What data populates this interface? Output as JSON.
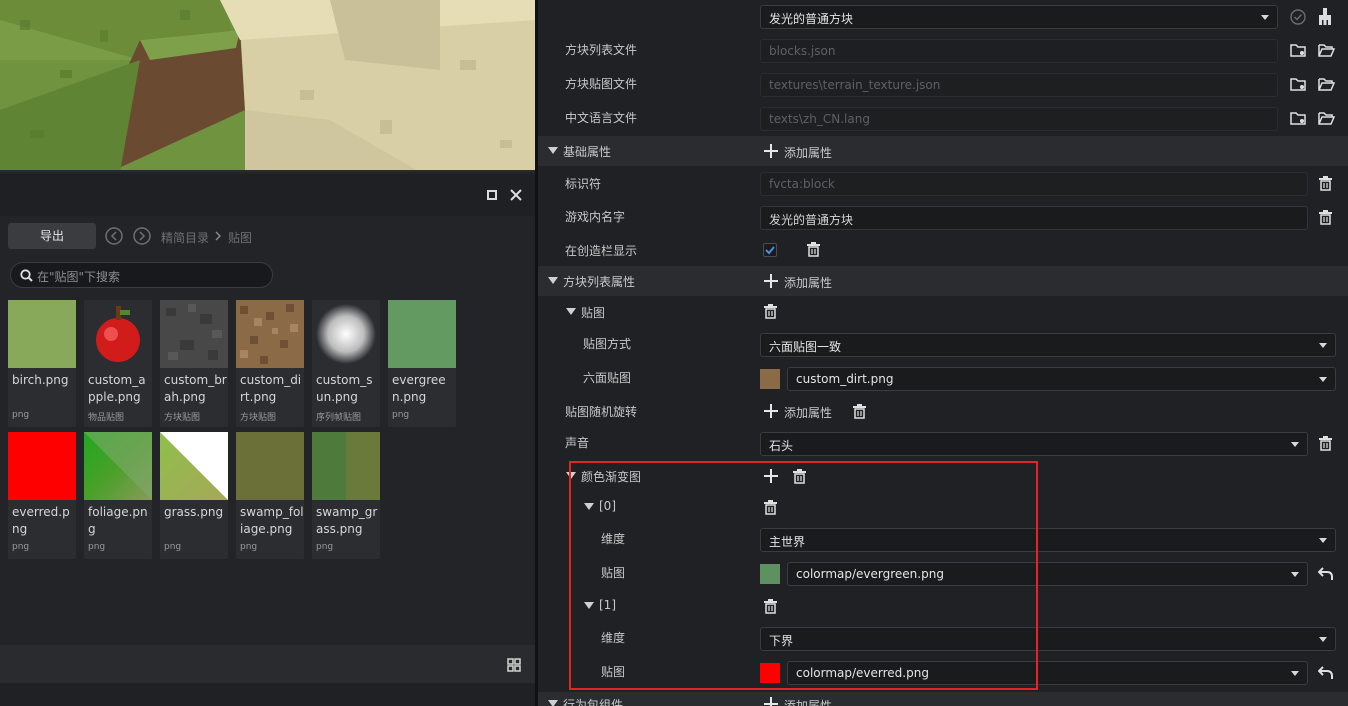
{
  "asset_panel": {
    "export_label": "导出",
    "breadcrumb": [
      "精简目录",
      "贴图"
    ],
    "search_placeholder": "在\"贴图\"下搜索",
    "tiles": [
      {
        "name": "birch.png",
        "tag": "png",
        "color": "#88a85a"
      },
      {
        "name": "custom_apple.png",
        "tag": "物品贴图",
        "color": "#cc1d1d"
      },
      {
        "name": "custom_brah.png",
        "tag": "方块贴图",
        "color": "#4a4a4a"
      },
      {
        "name": "custom_dirt.png",
        "tag": "方块贴图",
        "color": "#8b6a48"
      },
      {
        "name": "custom_sun.png",
        "tag": "序列帧贴图",
        "color": "#bcbcbc"
      },
      {
        "name": "evergreen.png",
        "tag": "png",
        "color": "#629a62"
      },
      {
        "name": "everred.png",
        "tag": "png",
        "color": "#ff0000"
      },
      {
        "name": "foliage.png",
        "tag": "png",
        "color": "#4aa02a"
      },
      {
        "name": "grass.png",
        "tag": "png",
        "color": "#8fb45a"
      },
      {
        "name": "swamp_foliage.png",
        "tag": "png",
        "color": "#6a7038"
      },
      {
        "name": "swamp_grass.png",
        "tag": "png",
        "color": "#4e7a3c"
      }
    ]
  },
  "inspector": {
    "block_select": "发光的普通方块",
    "rows_top": [
      {
        "label": "方块列表文件",
        "value": "blocks.json"
      },
      {
        "label": "方块贴图文件",
        "value": "textures\\terrain_texture.json"
      },
      {
        "label": "中文语言文件",
        "value": "texts\\zh_CN.lang"
      }
    ],
    "section_basic": "基础属性",
    "add_property": "添加属性",
    "identifier_label": "标识符",
    "identifier_value": "fvcta:block",
    "ingame_name_label": "游戏内名字",
    "ingame_name_value": "发光的普通方块",
    "creative_label": "在创造栏显示",
    "section_blocklist": "方块列表属性",
    "texture_label": "贴图",
    "texture_mode_label": "贴图方式",
    "texture_mode_value": "六面贴图一致",
    "six_face_label": "六面贴图",
    "six_face_value": "custom_dirt.png",
    "random_rotate_label": "贴图随机旋转",
    "sound_label": "声音",
    "sound_value": "石头",
    "gradient_label": "颜色渐变图",
    "entries": [
      {
        "index": "[0]",
        "dim_label": "维度",
        "dim_value": "主世界",
        "tex_label": "贴图",
        "tex_value": "colormap/evergreen.png",
        "swatch": "#5f9160"
      },
      {
        "index": "[1]",
        "dim_label": "维度",
        "dim_value": "下界",
        "tex_label": "贴图",
        "tex_value": "colormap/everred.png",
        "swatch": "#ff0000"
      }
    ],
    "section_behavior": "行为包组件",
    "highlight_color": "#e0242a"
  }
}
